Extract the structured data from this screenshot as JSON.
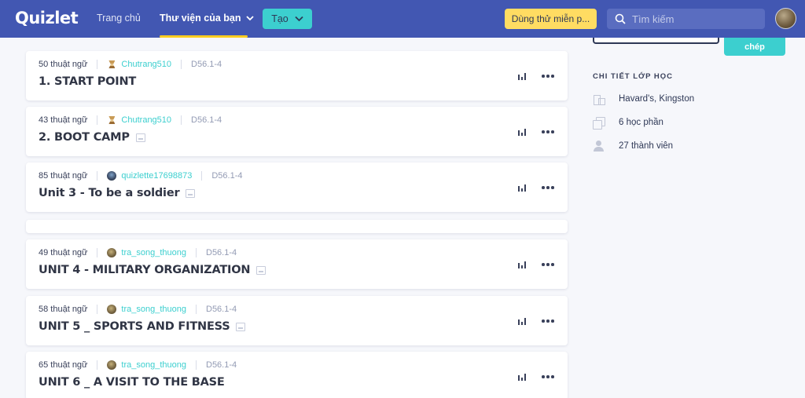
{
  "nav": {
    "logo": "Quizlet",
    "home": "Trang chủ",
    "library": "Thư viện của bạn",
    "create": "Tạo",
    "trial": "Dùng thử miễn p...",
    "search_placeholder": "Tìm kiếm"
  },
  "sets": [
    {
      "terms": "50 thuật ngữ",
      "user": "Chutrang510",
      "avatar": "chu",
      "class": "D56.1-4",
      "title": "1. START POINT",
      "has_image": false
    },
    {
      "terms": "43 thuật ngữ",
      "user": "Chutrang510",
      "avatar": "chu",
      "class": "D56.1-4",
      "title": "2. BOOT CAMP",
      "has_image": true
    },
    {
      "terms": "85 thuật ngữ",
      "user": "quizlette17698873",
      "avatar": "quiz",
      "class": "D56.1-4",
      "title": "Unit 3 - To be a soldier",
      "has_image": true
    },
    {
      "terms": "49 thuật ngữ",
      "user": "tra_song_thuong",
      "avatar": "tra",
      "class": "D56.1-4",
      "title": "UNIT 4 - MILITARY ORGANIZATION",
      "has_image": true
    },
    {
      "terms": "58 thuật ngữ",
      "user": "tra_song_thuong",
      "avatar": "tra",
      "class": "D56.1-4",
      "title": "UNIT 5 _ SPORTS AND FITNESS",
      "has_image": true
    },
    {
      "terms": "65 thuật ngữ",
      "user": "tra_song_thuong",
      "avatar": "tra",
      "class": "D56.1-4",
      "title": "UNIT 6 _ A VISIT TO THE BASE",
      "has_image": false
    }
  ],
  "panel": {
    "copy_button": "chép",
    "details_title": "CHI TIẾT LỚP HỌC",
    "school": "Havard's, Kingston",
    "sets_count": "6 học phần",
    "members": "27 thành viên"
  }
}
